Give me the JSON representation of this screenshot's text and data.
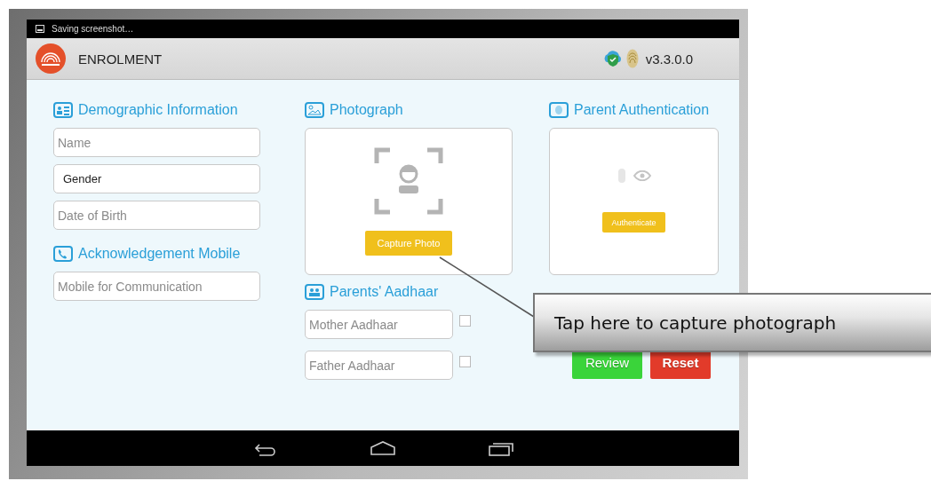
{
  "status_bar": {
    "text": "Saving screenshot…"
  },
  "app_bar": {
    "title": "ENROLMENT",
    "version": "v3.3.0.0"
  },
  "demographic": {
    "heading": "Demographic Information",
    "fields": [
      {
        "placeholder": "Name"
      },
      {
        "value": "Gender"
      },
      {
        "placeholder": "Date of Birth"
      }
    ]
  },
  "acknowledgement": {
    "heading": "Acknowledgement Mobile",
    "field": {
      "placeholder": "Mobile for Communication"
    }
  },
  "photograph": {
    "heading": "Photograph",
    "button": "Capture Photo"
  },
  "parents_aadhaar": {
    "heading": "Parents' Aadhaar",
    "fields": [
      {
        "placeholder": "Mother Aadhaar",
        "checked": false
      },
      {
        "placeholder": "Father Aadhaar",
        "checked": false
      }
    ]
  },
  "parent_authentication": {
    "heading": "Parent Authentication",
    "button": "Authenticate"
  },
  "actions": [
    {
      "label": "Review",
      "kind": "review"
    },
    {
      "label": "Reset",
      "kind": "reset"
    }
  ],
  "callout": {
    "text": "Tap here to capture photograph"
  }
}
